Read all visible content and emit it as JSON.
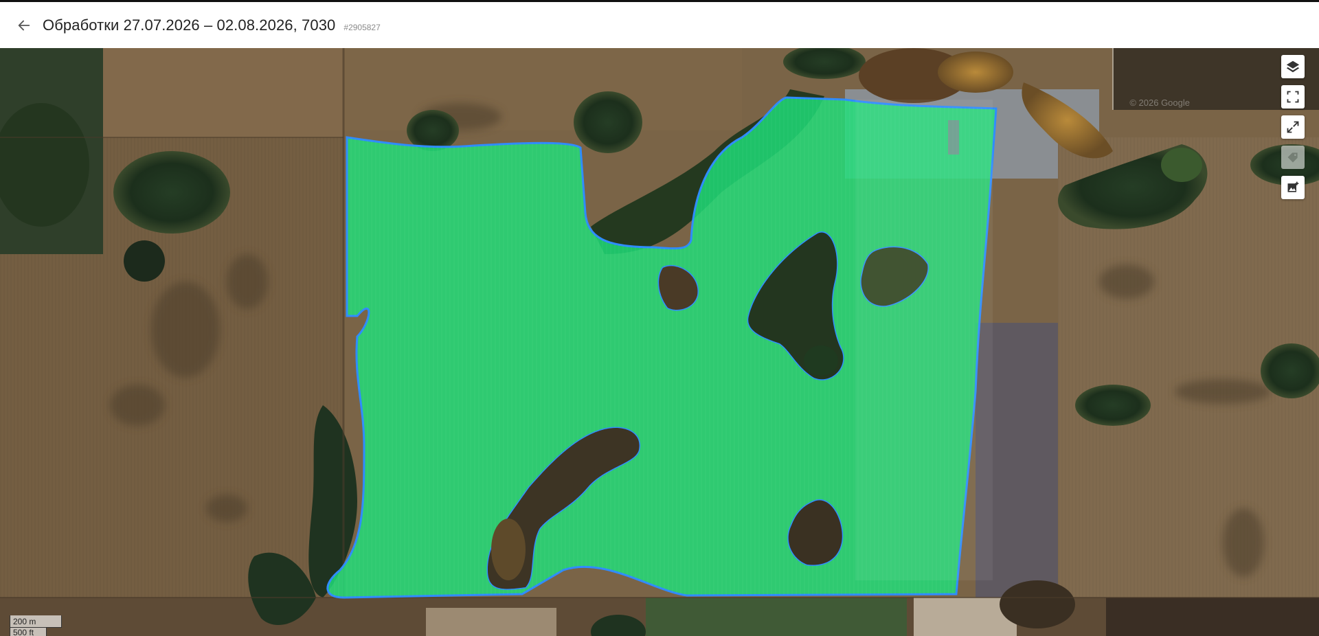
{
  "header": {
    "title": "Обработки 27.07.2026 – 02.08.2026, 7030",
    "record_id": "#2905827"
  },
  "map": {
    "controls": [
      {
        "name": "layers-button",
        "icon": "layers-icon",
        "disabled": false
      },
      {
        "name": "fit-bounds-button",
        "icon": "fit-bounds-icon",
        "disabled": false
      },
      {
        "name": "fullscreen-button",
        "icon": "expand-icon",
        "disabled": false
      },
      {
        "name": "labels-button",
        "icon": "tag-icon",
        "disabled": true
      },
      {
        "name": "add-image-button",
        "icon": "add-image-icon",
        "disabled": false
      }
    ],
    "scale": {
      "metric": "200 m",
      "imperial": "500 ft"
    },
    "attribution": "© 2026 Google",
    "colors": {
      "field_fill": "#1fe07a",
      "field_outline": "#2f8cff",
      "soil": "#7a6447",
      "forest": "#1f3520"
    }
  }
}
